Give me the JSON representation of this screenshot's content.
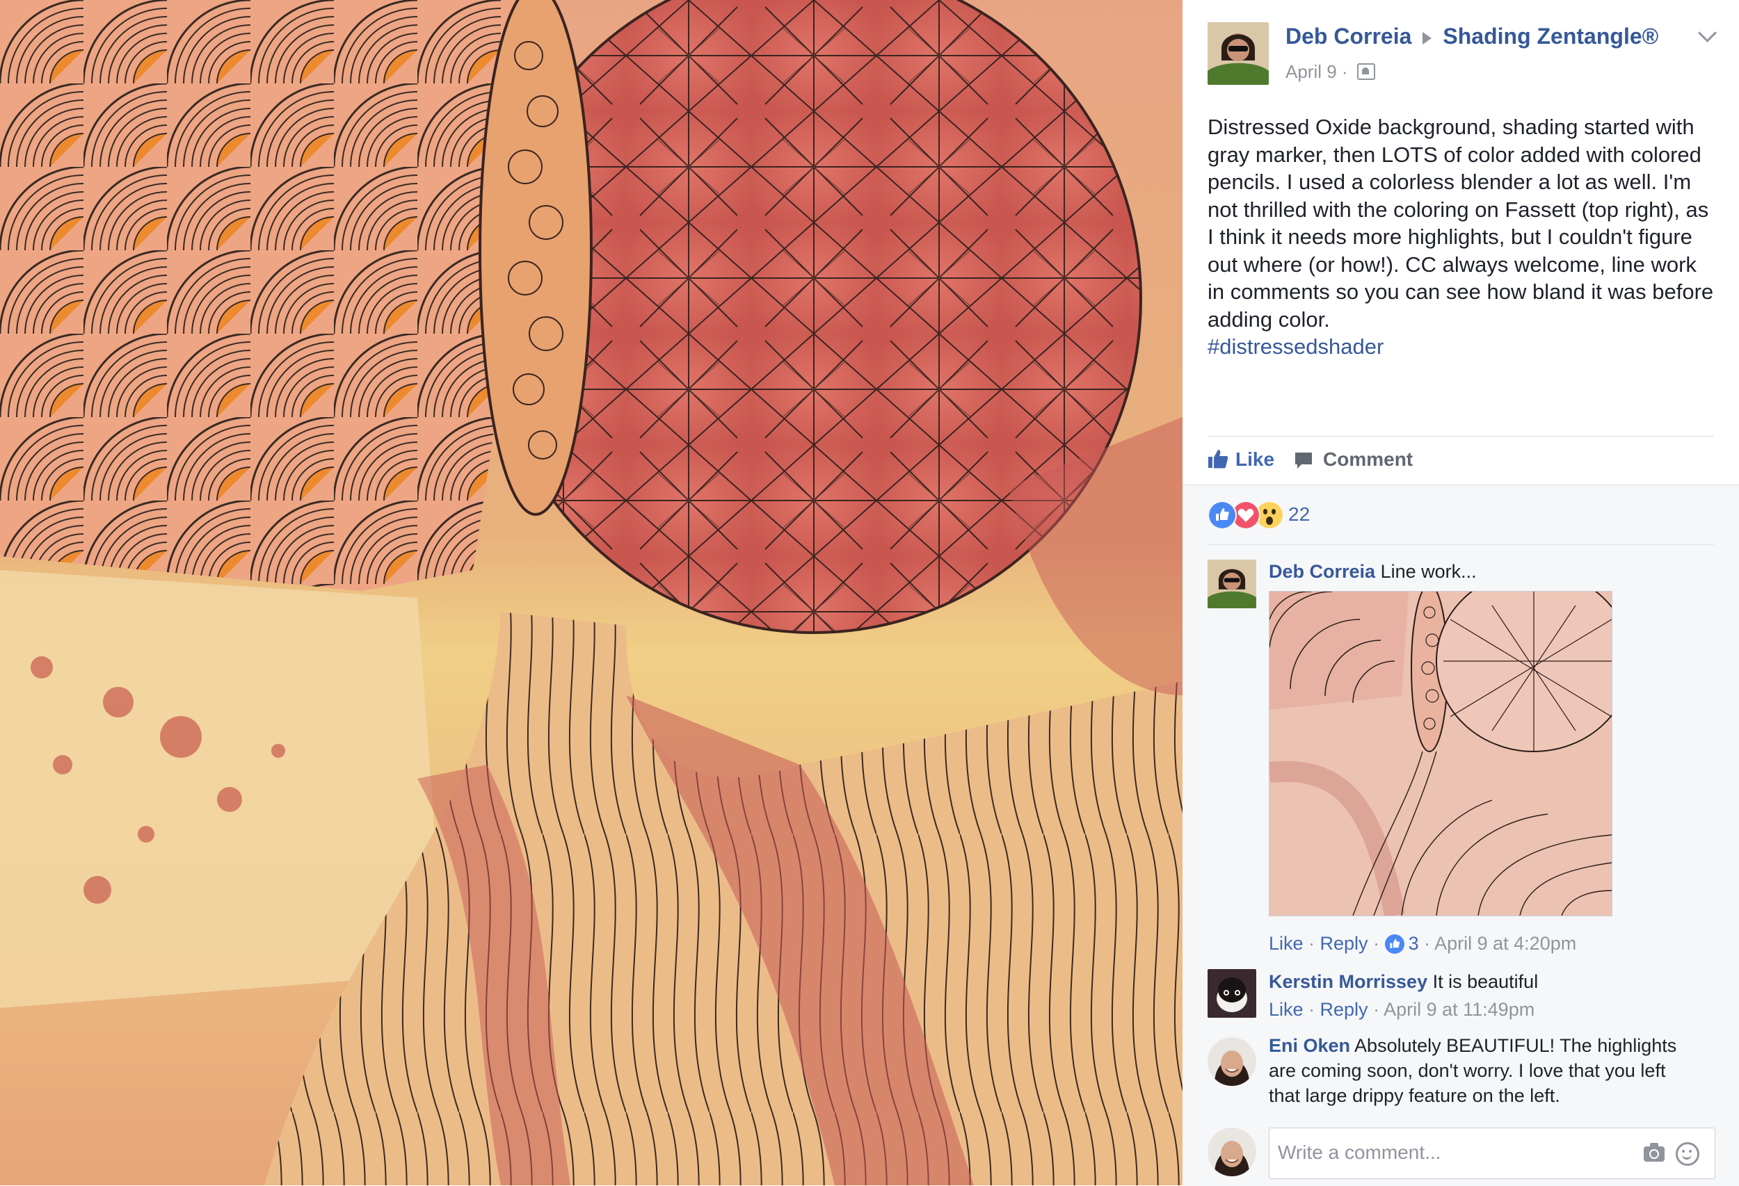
{
  "post": {
    "author": "Deb Correia",
    "group": "Shading Zentangle®",
    "date": "April 9 ·",
    "audience_icon": "group-audience-icon",
    "text": "Distressed Oxide background, shading started with gray marker, then LOTS of color added with colored pencils. I used a colorless blender a lot as well. I'm not thrilled with the coloring on Fassett (top right), as I think it needs more highlights, but I couldn't figure out where (or how!). CC always welcome, line work in comments so you can see how bland it was before adding color.",
    "hashtag": "#distressedshader"
  },
  "actions": {
    "like": "Like",
    "comment": "Comment"
  },
  "reactions": {
    "icons": [
      "like-reaction-icon",
      "love-reaction-icon",
      "wow-reaction-icon"
    ],
    "count": "22"
  },
  "comments": [
    {
      "name": "Deb Correia",
      "text": "Line work...",
      "like": "Like",
      "reply": "Reply",
      "reaction_count": "3",
      "time": "April 9 at 4:20pm"
    },
    {
      "name": "Kerstin Morrissey",
      "text": "It is beautiful",
      "like": "Like",
      "reply": "Reply",
      "time": "April 9 at 11:49pm"
    },
    {
      "name": "Eni Oken",
      "text": "Absolutely BEAUTIFUL! The highlights are coming soon, don't worry. I love that you left that large drippy feature on the left."
    }
  ],
  "composer": {
    "placeholder": "Write a comment..."
  },
  "colors": {
    "link": "#365899",
    "action_blue": "#4267b2",
    "meta_grey": "#90949c",
    "panel_bg": "#f6f7f9"
  }
}
